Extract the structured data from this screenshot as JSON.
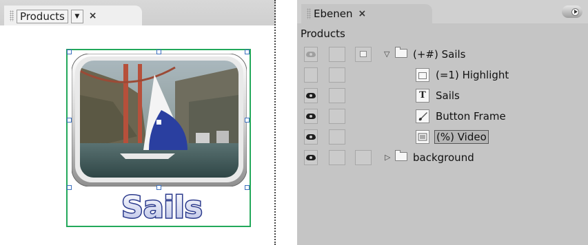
{
  "document_panel": {
    "tab_label": "Products",
    "tab_menu_glyph": "▼",
    "close_glyph": "×",
    "button_text": "Sails"
  },
  "layers_panel": {
    "tab_label": "Ebenen",
    "close_glyph": "×",
    "document_name": "Products",
    "layers": [
      {
        "name": "(+#) Sails",
        "visible": true,
        "type": "folder",
        "expanded": true
      },
      {
        "name": "(=1) Highlight",
        "visible": false,
        "type": "image"
      },
      {
        "name": "Sails",
        "visible": true,
        "type": "text",
        "icon_glyph": "T"
      },
      {
        "name": "Button Frame",
        "visible": true,
        "type": "brush"
      },
      {
        "name": "(%) Video",
        "visible": true,
        "type": "video",
        "selected": true
      },
      {
        "name": "background",
        "visible": true,
        "type": "folder",
        "expanded": false
      }
    ]
  },
  "colors": {
    "selection_green": "#22a85a",
    "handle_blue": "#3a6fbd",
    "layers_bg": "#c5c5c5"
  }
}
